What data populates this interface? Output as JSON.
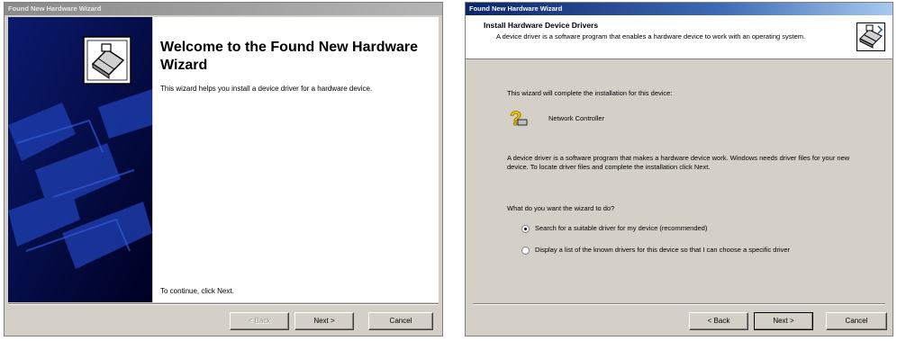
{
  "wizard1": {
    "title_bar": "Found New Hardware Wizard",
    "heading": "Welcome to the Found New Hardware Wizard",
    "description": "This wizard helps you install a device driver for a hardware device.",
    "continue_text": "To continue, click Next.",
    "buttons": {
      "back": "< Back",
      "next": "Next >",
      "cancel": "Cancel"
    }
  },
  "wizard2": {
    "title_bar": "Found New Hardware Wizard",
    "header_title": "Install Hardware Device Drivers",
    "header_subtitle": "A device driver is a software program that enables a hardware device to work with an operating system.",
    "intro": "This wizard will complete the installation for this device:",
    "device_name": "Network Controller",
    "explanation": "A device driver is a software program that makes a hardware device work. Windows needs driver files for your new device. To locate driver files and complete the installation click Next.",
    "question": "What do you want the wizard to do?",
    "options": [
      {
        "label": "Search for a suitable driver for my device (recommended)",
        "checked": true
      },
      {
        "label": "Display a list of the known drivers for this device so that I can choose a specific driver",
        "checked": false
      }
    ],
    "buttons": {
      "back": "< Back",
      "next": "Next >",
      "cancel": "Cancel"
    }
  },
  "colors": {
    "dialog_face": "#d4d0c8",
    "title_active": "#0a246a",
    "title_inactive": "#8a8a8a",
    "banner": "#000033"
  },
  "icons": {
    "wizard1_banner_icon": "hardware-install-icon",
    "wizard2_header_icon": "hardware-install-icon",
    "device_icon": "unknown-device-question-icon"
  }
}
